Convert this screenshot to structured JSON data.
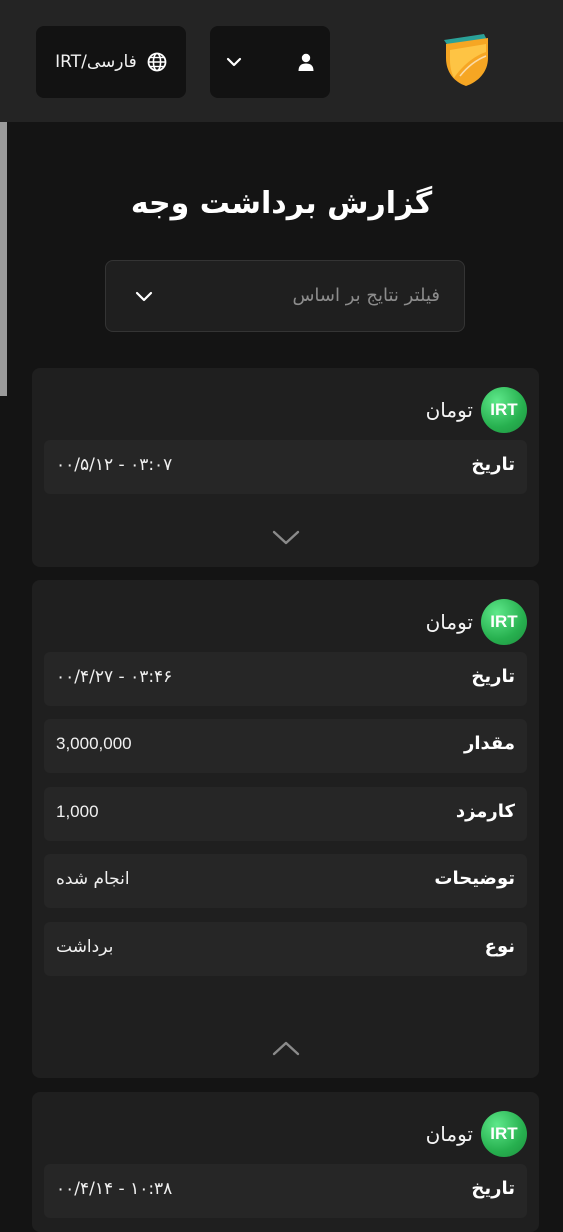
{
  "header": {
    "language_label": "فارسی/IRT",
    "colors": {
      "header_bg": "#242424",
      "button_bg": "#121212"
    }
  },
  "page": {
    "title": "گزارش برداشت وجه",
    "filter_placeholder": "فیلتر نتایج بر اساس"
  },
  "cards": [
    {
      "currency_code": "IRT",
      "currency_name": "تومان",
      "expanded": false,
      "rows": [
        {
          "key": "تاریخ",
          "value": "۰۳:۰۷ - ۰۰/۵/۱۲"
        }
      ]
    },
    {
      "currency_code": "IRT",
      "currency_name": "تومان",
      "expanded": true,
      "rows": [
        {
          "key": "تاریخ",
          "value": "۰۳:۴۶ - ۰۰/۴/۲۷"
        },
        {
          "key": "مقدار",
          "value": "3,000,000"
        },
        {
          "key": "کارمزد",
          "value": "1,000"
        },
        {
          "key": "توضیحات",
          "value": "انجام شده"
        },
        {
          "key": "نوع",
          "value": "برداشت"
        }
      ]
    },
    {
      "currency_code": "IRT",
      "currency_name": "تومان",
      "expanded": false,
      "rows": [
        {
          "key": "تاریخ",
          "value": "۱۰:۳۸ - ۰۰/۴/۱۴"
        }
      ]
    }
  ],
  "icons": {
    "language": "globe-icon",
    "user": "user-icon",
    "dropdown": "chevron-down-icon",
    "collapse": "chevron-up-icon",
    "brand": "shield-logo"
  },
  "colors": {
    "background": "#141414",
    "card": "#1f1f1f",
    "row": "#262626",
    "badge_green": "#27b04f",
    "logo_orange": "#f6a623"
  }
}
